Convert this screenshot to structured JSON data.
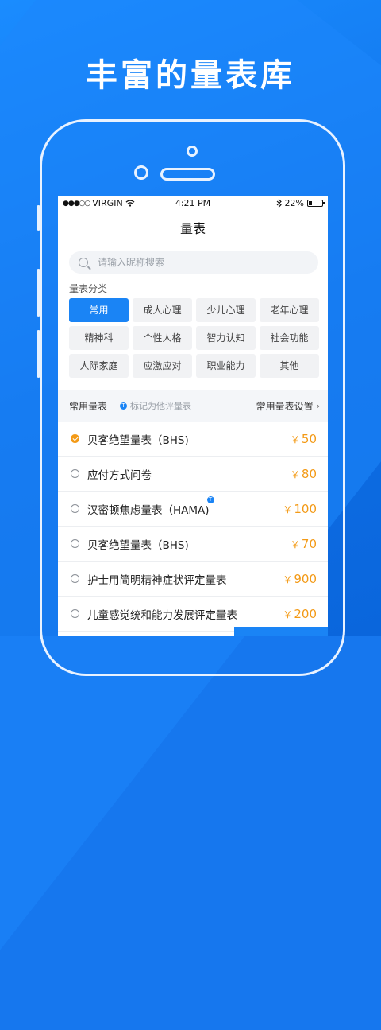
{
  "headline": "丰富的量表库",
  "status_bar": {
    "carrier": "VIRGIN",
    "time": "4:21 PM",
    "battery": "22%",
    "battery_level": 0.22
  },
  "screen_title": "量表",
  "search": {
    "placeholder": "请输入昵称搜索"
  },
  "category_section_label": "量表分类",
  "categories": [
    {
      "label": "常用",
      "active": true
    },
    {
      "label": "成人心理",
      "active": false
    },
    {
      "label": "少儿心理",
      "active": false
    },
    {
      "label": "老年心理",
      "active": false
    },
    {
      "label": "精神科",
      "active": false
    },
    {
      "label": "个性人格",
      "active": false
    },
    {
      "label": "智力认知",
      "active": false
    },
    {
      "label": "社会功能",
      "active": false
    },
    {
      "label": "人际家庭",
      "active": false
    },
    {
      "label": "应激应对",
      "active": false
    },
    {
      "label": "职业能力",
      "active": false
    },
    {
      "label": "其他",
      "active": false
    }
  ],
  "list_header": {
    "title": "常用量表",
    "note": "标记为他评量表",
    "settings_label": "常用量表设置",
    "badge_letter": "T"
  },
  "currency": "￥",
  "scales": [
    {
      "name": "贝客绝望量表（BHS)",
      "price": "50",
      "checked": true,
      "other_rated": false
    },
    {
      "name": "应付方式问卷",
      "price": "80",
      "checked": false,
      "other_rated": false
    },
    {
      "name": "汉密顿焦虑量表（HAMA)",
      "price": "100",
      "checked": false,
      "other_rated": true
    },
    {
      "name": "贝客绝望量表（BHS)",
      "price": "70",
      "checked": false,
      "other_rated": false
    },
    {
      "name": "护士用简明精神症状评定量表",
      "price": "900",
      "checked": false,
      "other_rated": false
    },
    {
      "name": "儿童感觉统和能力发展评定量表",
      "price": "200",
      "checked": false,
      "other_rated": false
    }
  ],
  "colors": {
    "accent": "#1a84f5",
    "price": "#f39a16",
    "background": "#1677ee"
  }
}
